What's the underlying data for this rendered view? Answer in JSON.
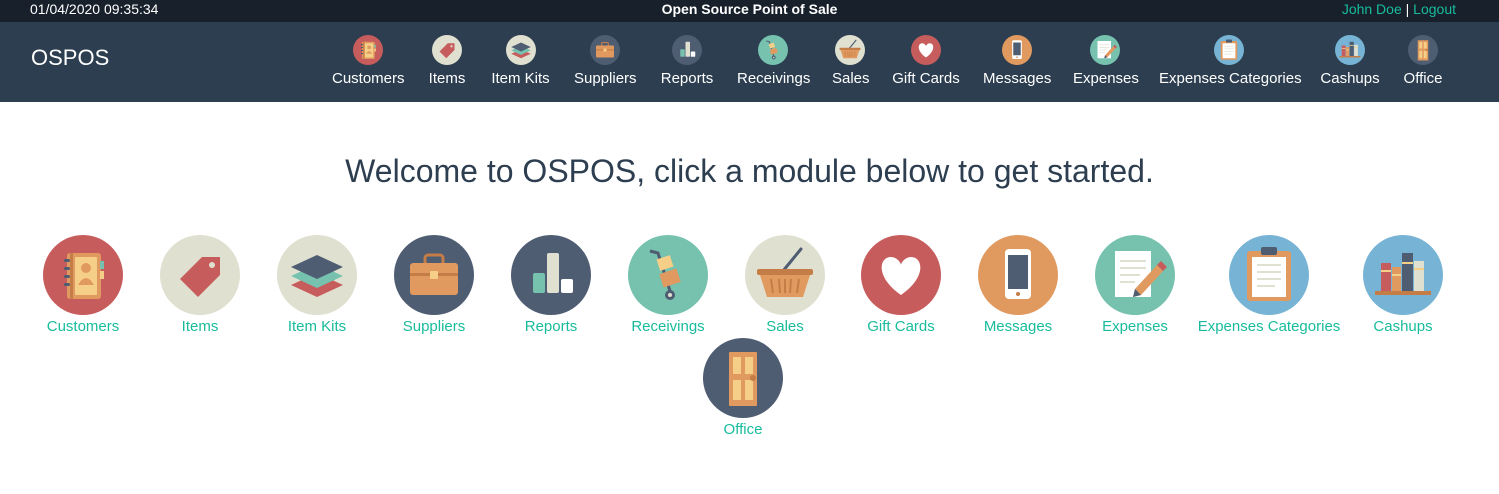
{
  "topbar": {
    "datetime": "01/04/2020 09:35:34",
    "title": "Open Source Point of Sale",
    "user_name": "John Doe",
    "separator": "|",
    "logout_label": "Logout"
  },
  "navbar": {
    "brand": "OSPOS",
    "items": [
      {
        "label": "Customers",
        "icon": "customers-icon"
      },
      {
        "label": "Items",
        "icon": "tag-icon"
      },
      {
        "label": "Item Kits",
        "icon": "layers-icon"
      },
      {
        "label": "Suppliers",
        "icon": "briefcase-icon"
      },
      {
        "label": "Reports",
        "icon": "bar-chart-icon"
      },
      {
        "label": "Receivings",
        "icon": "hand-truck-icon"
      },
      {
        "label": "Sales",
        "icon": "basket-icon"
      },
      {
        "label": "Gift Cards",
        "icon": "heart-icon"
      },
      {
        "label": "Messages",
        "icon": "phone-icon"
      },
      {
        "label": "Expenses",
        "icon": "notepad-pencil-icon"
      },
      {
        "label": "Expenses Categories",
        "icon": "clipboard-icon"
      },
      {
        "label": "Cashups",
        "icon": "books-icon"
      },
      {
        "label": "Office",
        "icon": "door-icon"
      }
    ]
  },
  "main": {
    "welcome": "Welcome to OSPOS, click a module below to get started.",
    "modules": [
      {
        "label": "Customers"
      },
      {
        "label": "Items"
      },
      {
        "label": "Item Kits"
      },
      {
        "label": "Suppliers"
      },
      {
        "label": "Reports"
      },
      {
        "label": "Receivings"
      },
      {
        "label": "Sales"
      },
      {
        "label": "Gift Cards"
      },
      {
        "label": "Messages"
      },
      {
        "label": "Expenses"
      },
      {
        "label": "Expenses Categories"
      },
      {
        "label": "Cashups"
      },
      {
        "label": "Office"
      }
    ]
  },
  "colors": {
    "topbar_bg": "#17202b",
    "navbar_bg": "#2c3e50",
    "accent": "#18bc9c",
    "heading": "#2c3e50"
  }
}
